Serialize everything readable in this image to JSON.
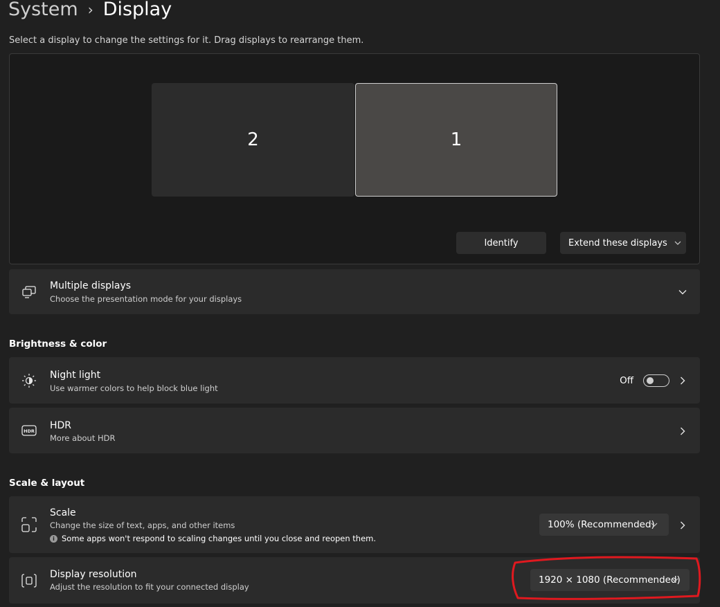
{
  "header": {
    "breadcrumb_parent": "System",
    "breadcrumb_current": "Display",
    "subtitle": "Select a display to change the settings for it. Drag displays to rearrange them."
  },
  "arrangement": {
    "monitors": [
      {
        "number": "2",
        "selected": false
      },
      {
        "number": "1",
        "selected": true
      }
    ],
    "identify_label": "Identify",
    "mode_label": "Extend these displays"
  },
  "multiple_displays": {
    "title": "Multiple displays",
    "description": "Choose the presentation mode for your displays",
    "icon": "multiple-displays-icon"
  },
  "brightness_section": {
    "heading": "Brightness & color",
    "night_light": {
      "title": "Night light",
      "description": "Use warmer colors to help block blue light",
      "state_label": "Off",
      "enabled": false,
      "icon": "brightness-icon"
    },
    "hdr": {
      "title": "HDR",
      "description": "More about HDR",
      "icon": "hdr-icon"
    }
  },
  "scale_section": {
    "heading": "Scale & layout",
    "scale": {
      "title": "Scale",
      "description": "Change the size of text, apps, and other items",
      "note": "Some apps won't respond to scaling changes until you close and reopen them.",
      "value": "100% (Recommended)",
      "icon": "scale-icon"
    },
    "resolution": {
      "title": "Display resolution",
      "description": "Adjust the resolution to fit your connected display",
      "value": "1920 × 1080 (Recommended)",
      "icon": "resolution-icon"
    }
  },
  "colors": {
    "background": "#202020",
    "card": "#2b2b2b",
    "annotation": "#e0191f"
  }
}
